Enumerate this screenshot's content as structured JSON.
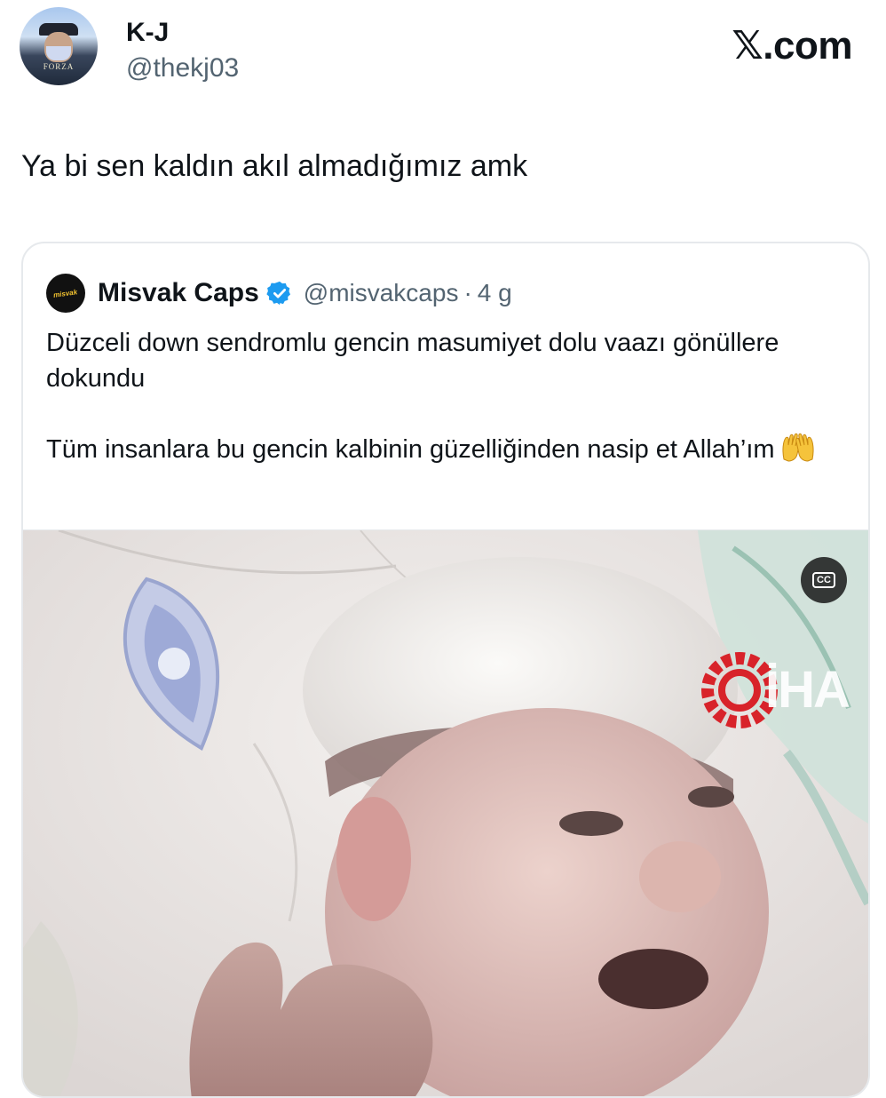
{
  "header": {
    "display_name": "K-J",
    "handle": "@thekj03",
    "site_logo": "𝕏.com",
    "avatar_brand": "FORZA"
  },
  "tweet": {
    "text": "Ya bi sen kaldın akıl almadığımız amk"
  },
  "quote": {
    "avatar_brand": "misvak",
    "name": "Misvak Caps",
    "verified_icon": "verified-badge-icon",
    "handle": "@misvakcaps",
    "separator": "·",
    "time": "4 g",
    "paragraph1": "Düzceli down sendromlu gencin masumiyet dolu vaazı gönüllere dokundu",
    "paragraph2": "Tüm insanlara bu gencin kalbinin güzelliğinden nasip et Allah’ım",
    "emoji": "raised-hands-icon"
  },
  "media": {
    "cc_label": "CC",
    "watermark_text": "İHA"
  },
  "colors": {
    "text_primary": "#0f1419",
    "text_secondary": "#536471",
    "verified_blue": "#1d9bf0",
    "card_border": "#e6e9ec",
    "watermark_red": "#d8232a"
  }
}
